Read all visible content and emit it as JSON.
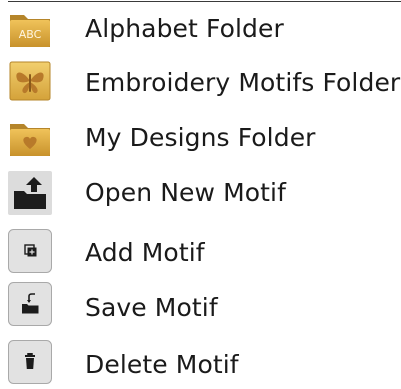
{
  "items": [
    {
      "label": "Alphabet Folder",
      "icon": "abc-folder-icon",
      "icon_text": "ABC"
    },
    {
      "label": "Embroidery Motifs Folder",
      "icon": "butterfly-folder-icon"
    },
    {
      "label": "My Designs Folder",
      "icon": "heart-folder-icon"
    },
    {
      "label": "Open New Motif",
      "icon": "open-folder-icon"
    },
    {
      "label": "Add Motif",
      "icon": "add-motif-icon"
    },
    {
      "label": "Save Motif",
      "icon": "save-motif-icon"
    },
    {
      "label": "Delete Motif",
      "icon": "delete-motif-icon"
    }
  ],
  "colors": {
    "folder_gold": "#d8a83a",
    "folder_gold_dark": "#b5852a",
    "icon_gray": "#d7d7d7",
    "icon_dark": "#1c1c1c",
    "text": "#1a1a1a"
  }
}
